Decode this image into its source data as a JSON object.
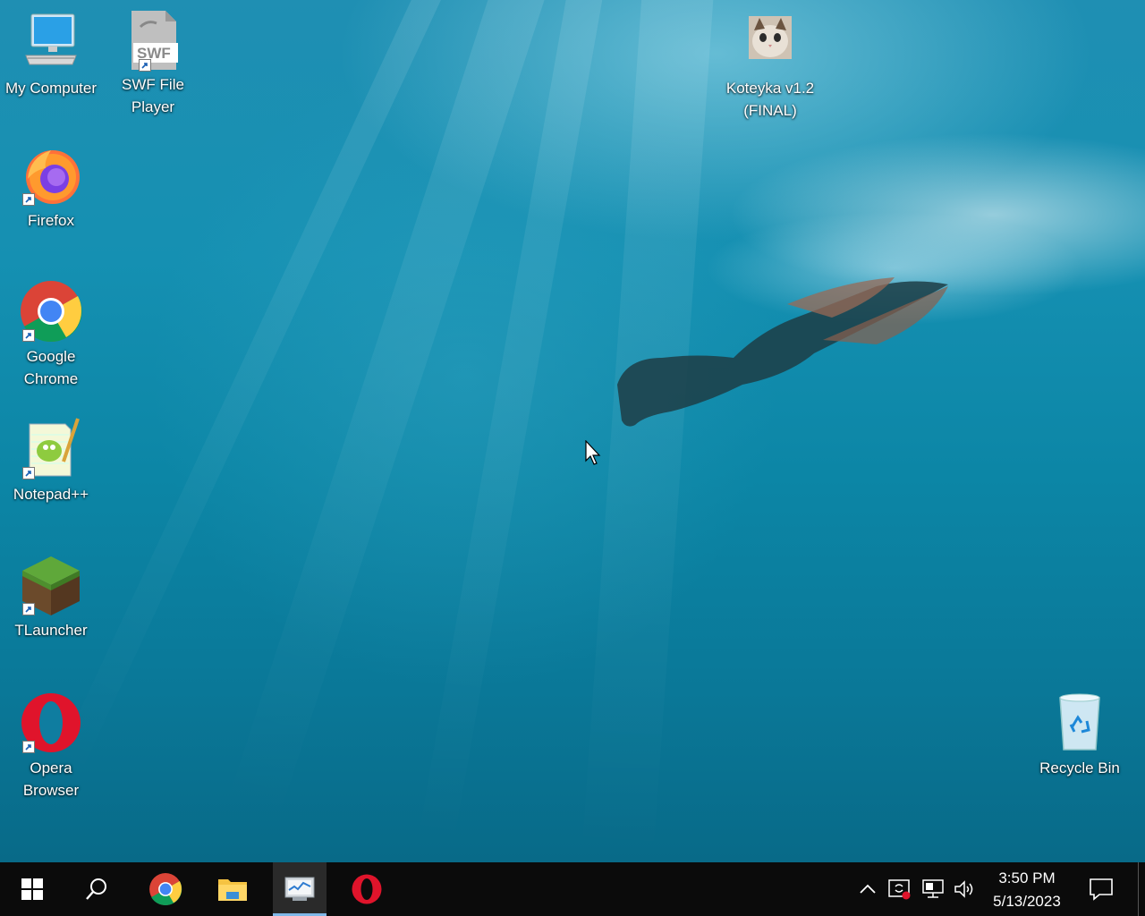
{
  "desktop": {
    "icons": [
      {
        "label_line1": "My Computer",
        "label_line2": ""
      },
      {
        "label_line1": "SWF File",
        "label_line2": "Player"
      },
      {
        "label_line1": "Koteyka v1.2",
        "label_line2": "(FINAL)"
      },
      {
        "label_line1": "Firefox",
        "label_line2": ""
      },
      {
        "label_line1": "Google",
        "label_line2": "Chrome"
      },
      {
        "label_line1": "Notepad++",
        "label_line2": ""
      },
      {
        "label_line1": "TLauncher",
        "label_line2": ""
      },
      {
        "label_line1": "Opera",
        "label_line2": "Browser"
      },
      {
        "label_line1": "Recycle Bin",
        "label_line2": ""
      }
    ],
    "swf_badge": "SWF"
  },
  "taskbar": {
    "pinned": [
      "start-icon",
      "search-icon",
      "chrome-icon",
      "file-explorer-icon",
      "resource-monitor-icon",
      "opera-icon"
    ],
    "tray": [
      "chevron-up-icon",
      "sync-icon",
      "network-icon",
      "volume-icon"
    ],
    "clock": {
      "time": "3:50 PM",
      "date": "5/13/2023"
    },
    "accent_color": "#7fb8e8"
  }
}
